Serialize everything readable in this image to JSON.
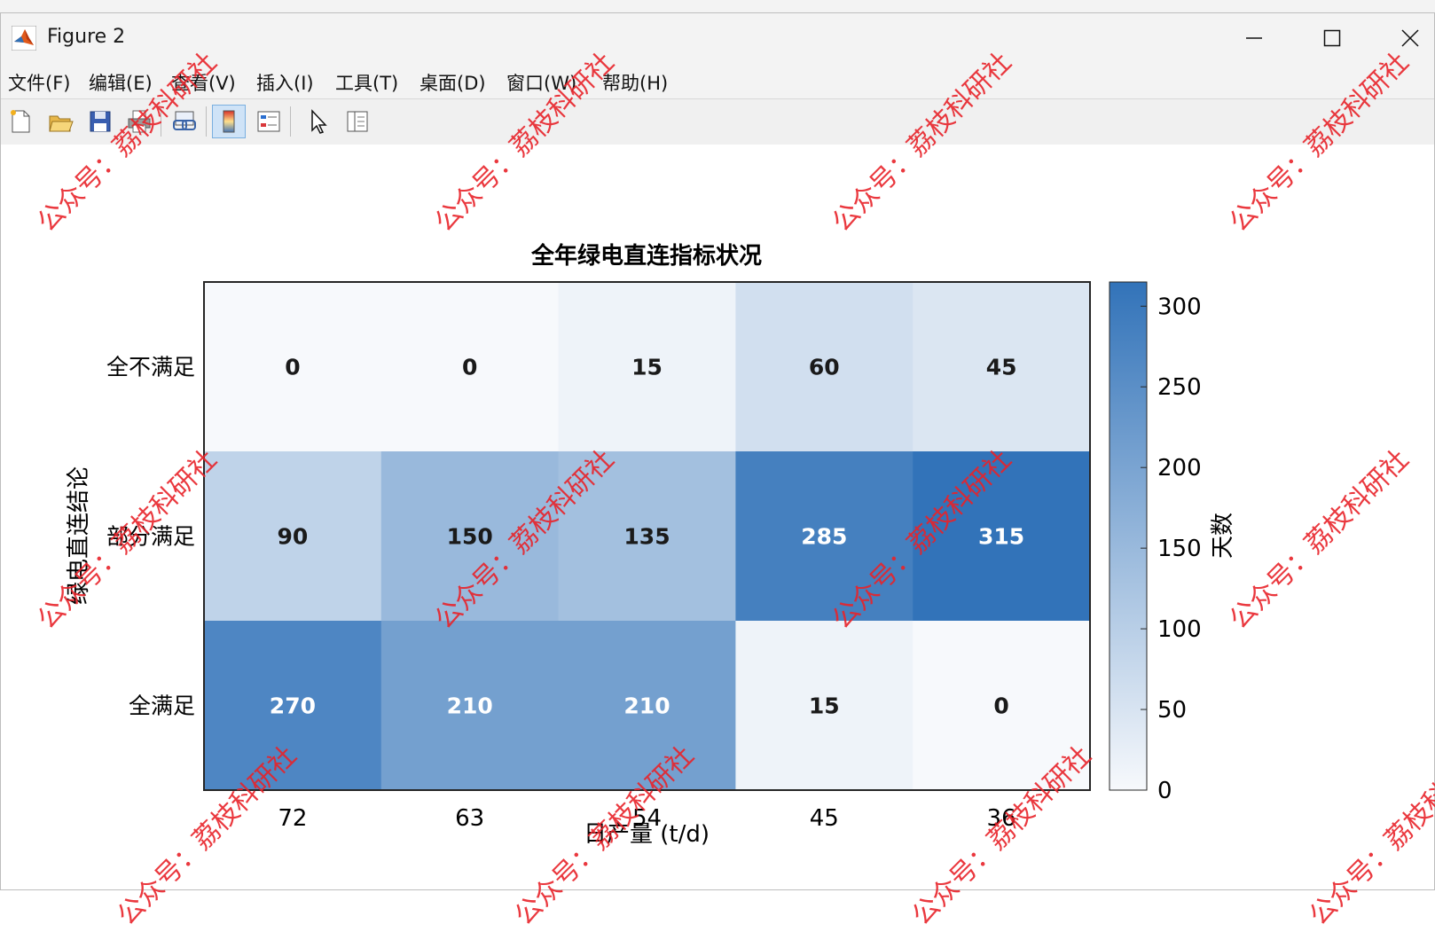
{
  "window": {
    "title": "Figure 2"
  },
  "menu": [
    "文件(F)",
    "编辑(E)",
    "查看(V)",
    "插入(I)",
    "工具(T)",
    "桌面(D)",
    "窗口(W)",
    "帮助(H)"
  ],
  "toolbar": [
    "new-figure-icon",
    "open-file-icon",
    "save-icon",
    "print-icon",
    "link-plot-icon",
    "insert-colorbar-icon",
    "insert-legend-icon",
    "edit-plot-pointer-icon",
    "property-inspector-icon"
  ],
  "colors": {
    "low": "#f7f9fc",
    "high": "#3273b9"
  },
  "chart_data": {
    "type": "heatmap",
    "title": "全年绿电直连指标状况",
    "xlabel": "日产量 (t/d)",
    "ylabel": "绿电直连结论",
    "x": [
      "72",
      "63",
      "54",
      "45",
      "36"
    ],
    "y": [
      "全不满足",
      "部分满足",
      "全满足"
    ],
    "values": [
      [
        0,
        0,
        15,
        60,
        45
      ],
      [
        90,
        150,
        135,
        285,
        315
      ],
      [
        270,
        210,
        210,
        15,
        0
      ]
    ],
    "colorbar": {
      "label": "天数",
      "ticks": [
        0,
        50,
        100,
        150,
        200,
        250,
        300
      ],
      "range": [
        0,
        315
      ]
    }
  },
  "watermark": "公众号：荔枝科研社"
}
